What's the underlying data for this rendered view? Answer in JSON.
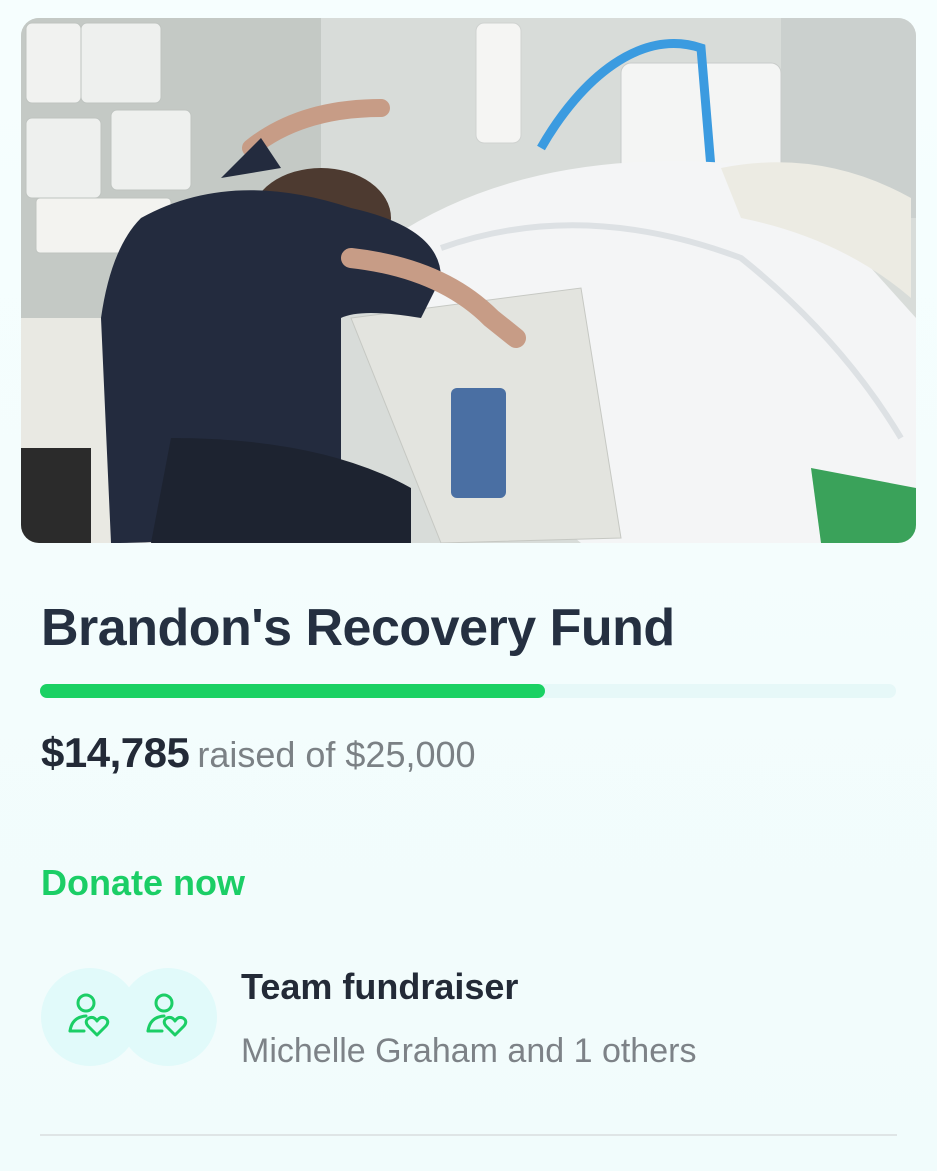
{
  "campaign": {
    "title": "Brandon's Recovery Fund",
    "progress_fraction": 0.59,
    "amount_raised": "$14,785",
    "goal_text": "raised of $25,000"
  },
  "actions": {
    "donate_label": "Donate now"
  },
  "team": {
    "title": "Team fundraiser",
    "organizers": "Michelle Graham and 1 others",
    "icons": [
      "user-heart-icon",
      "user-heart-icon"
    ]
  },
  "colors": {
    "accent": "#1ad163",
    "title": "#253041",
    "muted": "#7b8185",
    "background": "#f3fdfd"
  }
}
